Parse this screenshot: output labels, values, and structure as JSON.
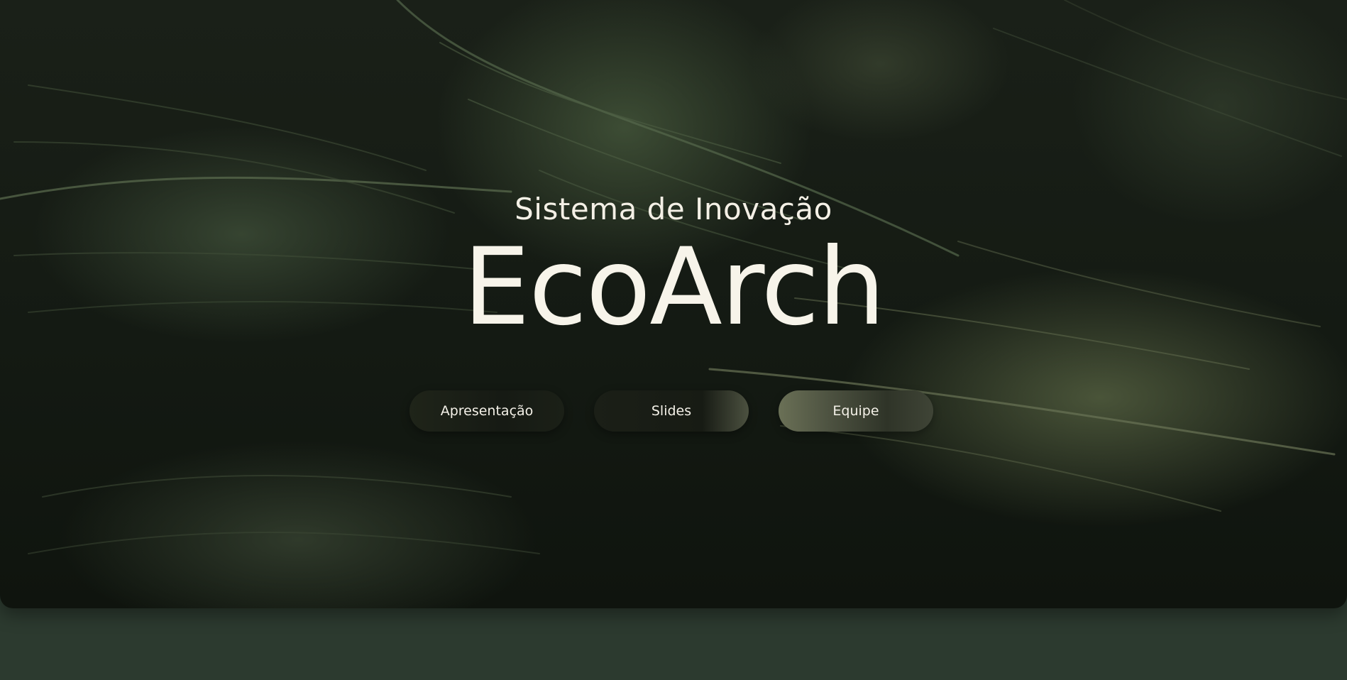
{
  "hero": {
    "subtitle": "Sistema de Inovação",
    "title": "EcoArch"
  },
  "nav": {
    "buttons": [
      {
        "label": "Apresentação"
      },
      {
        "label": "Slides"
      },
      {
        "label": "Equipe"
      }
    ]
  },
  "colors": {
    "footer_band": "#2c3a2f",
    "text": "#f4f0e6"
  }
}
